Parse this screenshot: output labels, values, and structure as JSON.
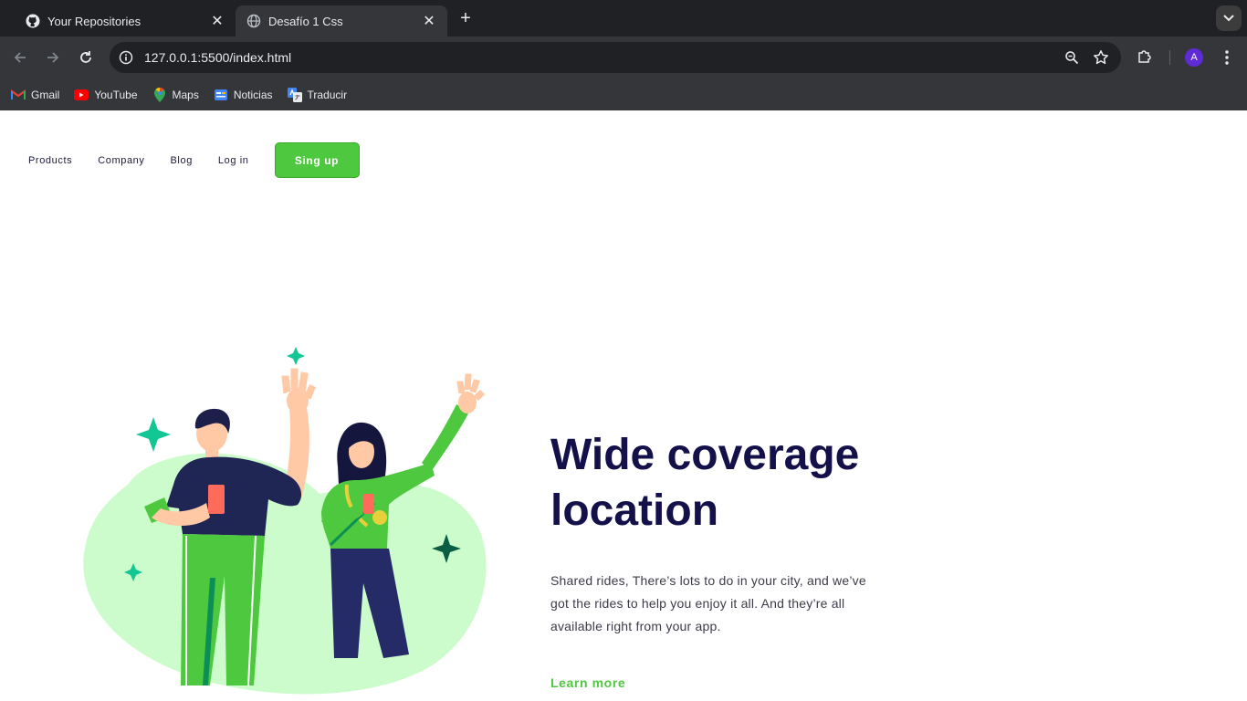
{
  "browser": {
    "tabs": [
      {
        "title": "Your Repositories",
        "icon": "github-icon",
        "active": false
      },
      {
        "title": "Desafío 1 Css",
        "icon": "globe-icon",
        "active": true
      }
    ],
    "url": "127.0.0.1:5500/index.html",
    "profile_initial": "A",
    "bookmarks": [
      {
        "label": "Gmail",
        "icon": "gmail-icon"
      },
      {
        "label": "YouTube",
        "icon": "youtube-icon"
      },
      {
        "label": "Maps",
        "icon": "maps-icon"
      },
      {
        "label": "Noticias",
        "icon": "news-icon"
      },
      {
        "label": "Traducir",
        "icon": "translate-icon"
      }
    ]
  },
  "nav": {
    "items": [
      "Products",
      "Company",
      "Blog",
      "Log in"
    ],
    "cta": "Sing up"
  },
  "hero": {
    "title": "Wide coverage location",
    "text": "Shared rides, There’s lots to do in your city, and we’ve got the rides to help you enjoy it all. And they’re all available right from your app.",
    "link": "Learn more"
  },
  "colors": {
    "brand_green": "#4ec83f",
    "title_navy": "#14104a",
    "blob_green": "#ccfccb"
  }
}
